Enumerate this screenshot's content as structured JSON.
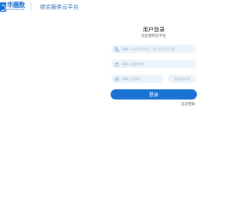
{
  "header": {
    "logo_cn": "华惠数",
    "logo_en": "HUAHUI SHU DATA",
    "title": "综合服务云平台"
  },
  "login": {
    "title": "用户登录",
    "subtitle": "欢迎使用云平台",
    "phone_placeholder": "请输入认证的手机号，非手机号无可登",
    "password_placeholder": "请输入登录密码",
    "code_placeholder": "请输入验证码",
    "get_code_label": "获取验证码",
    "submit_label": "登录",
    "forgot_label": "忘记密码"
  },
  "colors": {
    "brand": "#1a73d3",
    "field_bg": "#edf3fa",
    "title": "#2b6fb8"
  },
  "icons": {
    "phone": "phone-icon",
    "lock": "lock-icon",
    "shield": "shield-icon"
  }
}
